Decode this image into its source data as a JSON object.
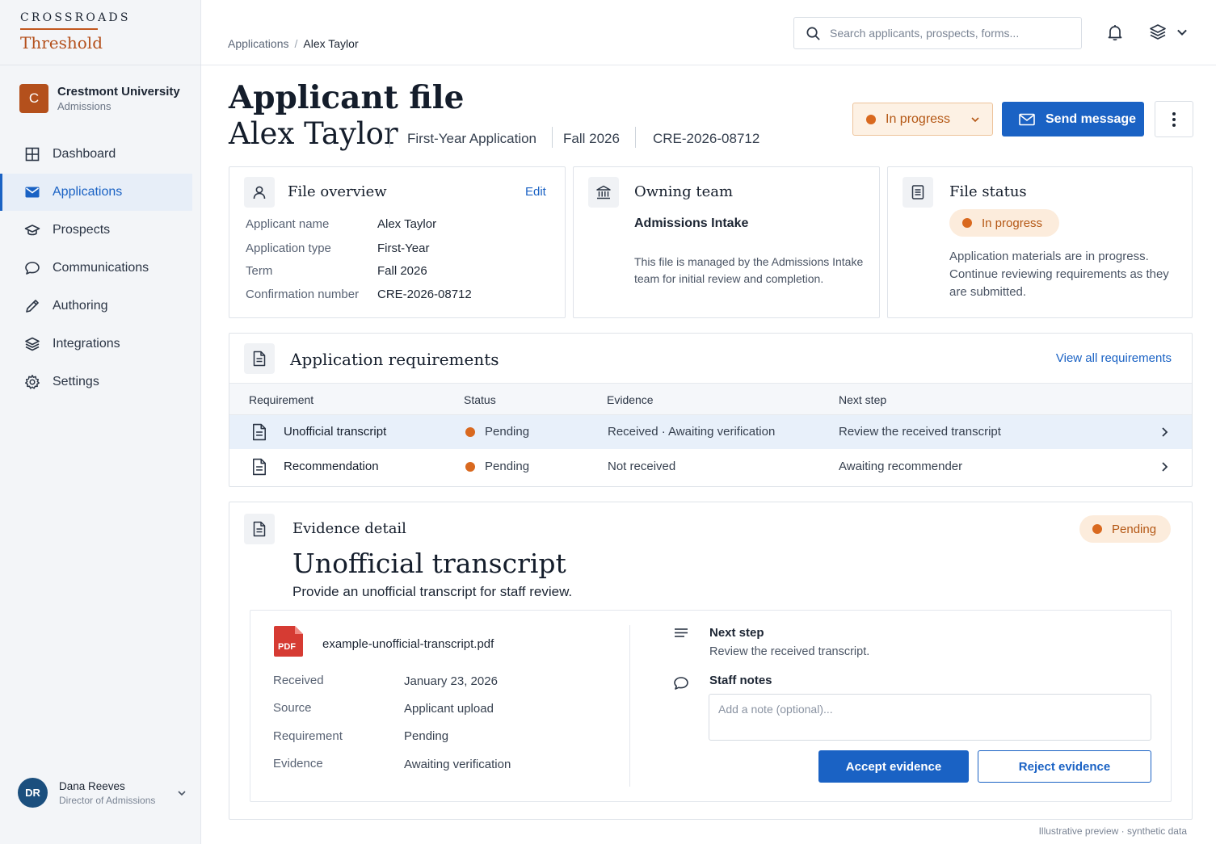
{
  "brand": {
    "top": "CROSSROADS",
    "name": "Threshold"
  },
  "org": {
    "initial": "C",
    "name": "Crestmont University",
    "sub": "Admissions"
  },
  "nav": [
    {
      "label": "Dashboard",
      "icon": "grid-icon"
    },
    {
      "label": "Applications",
      "icon": "mail-icon",
      "active": true
    },
    {
      "label": "Prospects",
      "icon": "graduation-cap-icon"
    },
    {
      "label": "Communications",
      "icon": "chat-icon"
    },
    {
      "label": "Authoring",
      "icon": "pencil-icon"
    },
    {
      "label": "Integrations",
      "icon": "layers-icon"
    },
    {
      "label": "Settings",
      "icon": "gear-icon"
    }
  ],
  "user": {
    "initials": "DR",
    "name": "Dana Reeves",
    "role": "Director of Admissions"
  },
  "breadcrumb": {
    "root": "Applications",
    "sep": "/",
    "current": "Alex Taylor"
  },
  "search": {
    "placeholder": "Search applicants, prospects, forms..."
  },
  "header": {
    "title": "Applicant file",
    "name": "Alex Taylor",
    "app_type": "First-Year Application",
    "term": "Fall 2026",
    "confirmation": "CRE-2026-08712",
    "status": "In progress",
    "send_label": "Send message"
  },
  "overview": {
    "title": "File overview",
    "edit": "Edit",
    "rows": [
      {
        "k": "Applicant name",
        "v": "Alex Taylor"
      },
      {
        "k": "Application type",
        "v": "First-Year"
      },
      {
        "k": "Term",
        "v": "Fall 2026"
      },
      {
        "k": "Confirmation number",
        "v": "CRE-2026-08712"
      }
    ]
  },
  "team": {
    "title": "Owning team",
    "name": "Admissions Intake",
    "desc": "This file is managed by the Admissions Intake team for initial review and completion."
  },
  "file_status": {
    "title": "File status",
    "badge": "In progress",
    "desc": "Application materials are in progress. Continue reviewing requirements as they are submitted."
  },
  "requirements": {
    "title": "Application requirements",
    "view_all": "View all requirements",
    "columns": [
      "Requirement",
      "Status",
      "Evidence",
      "Next step"
    ],
    "rows": [
      {
        "name": "Unofficial transcript",
        "status": "Pending",
        "evidence": "Received · Awaiting verification",
        "next": "Review the received transcript"
      },
      {
        "name": "Recommendation",
        "status": "Pending",
        "evidence": "Not received",
        "next": "Awaiting recommender"
      }
    ]
  },
  "evidence": {
    "label": "Evidence detail",
    "badge": "Pending",
    "title": "Unofficial transcript",
    "subtitle": "Provide an unofficial transcript for staff review.",
    "file_badge": "PDF",
    "filename": "example-unofficial-transcript.pdf",
    "rows": [
      {
        "k": "Received",
        "v": "January 23, 2026"
      },
      {
        "k": "Source",
        "v": "Applicant upload"
      },
      {
        "k": "Requirement",
        "v": "Pending"
      },
      {
        "k": "Evidence",
        "v": "Awaiting verification"
      }
    ],
    "next_label": "Next step",
    "next_text": "Review the received transcript.",
    "notes_label": "Staff notes",
    "notes_placeholder": "Add a note (optional)...",
    "accept": "Accept evidence",
    "reject": "Reject evidence"
  },
  "footer": "Illustrative preview · synthetic data",
  "colors": {
    "accent": "#1a62c4",
    "brand": "#b4501c",
    "pending": "#d9691f"
  }
}
